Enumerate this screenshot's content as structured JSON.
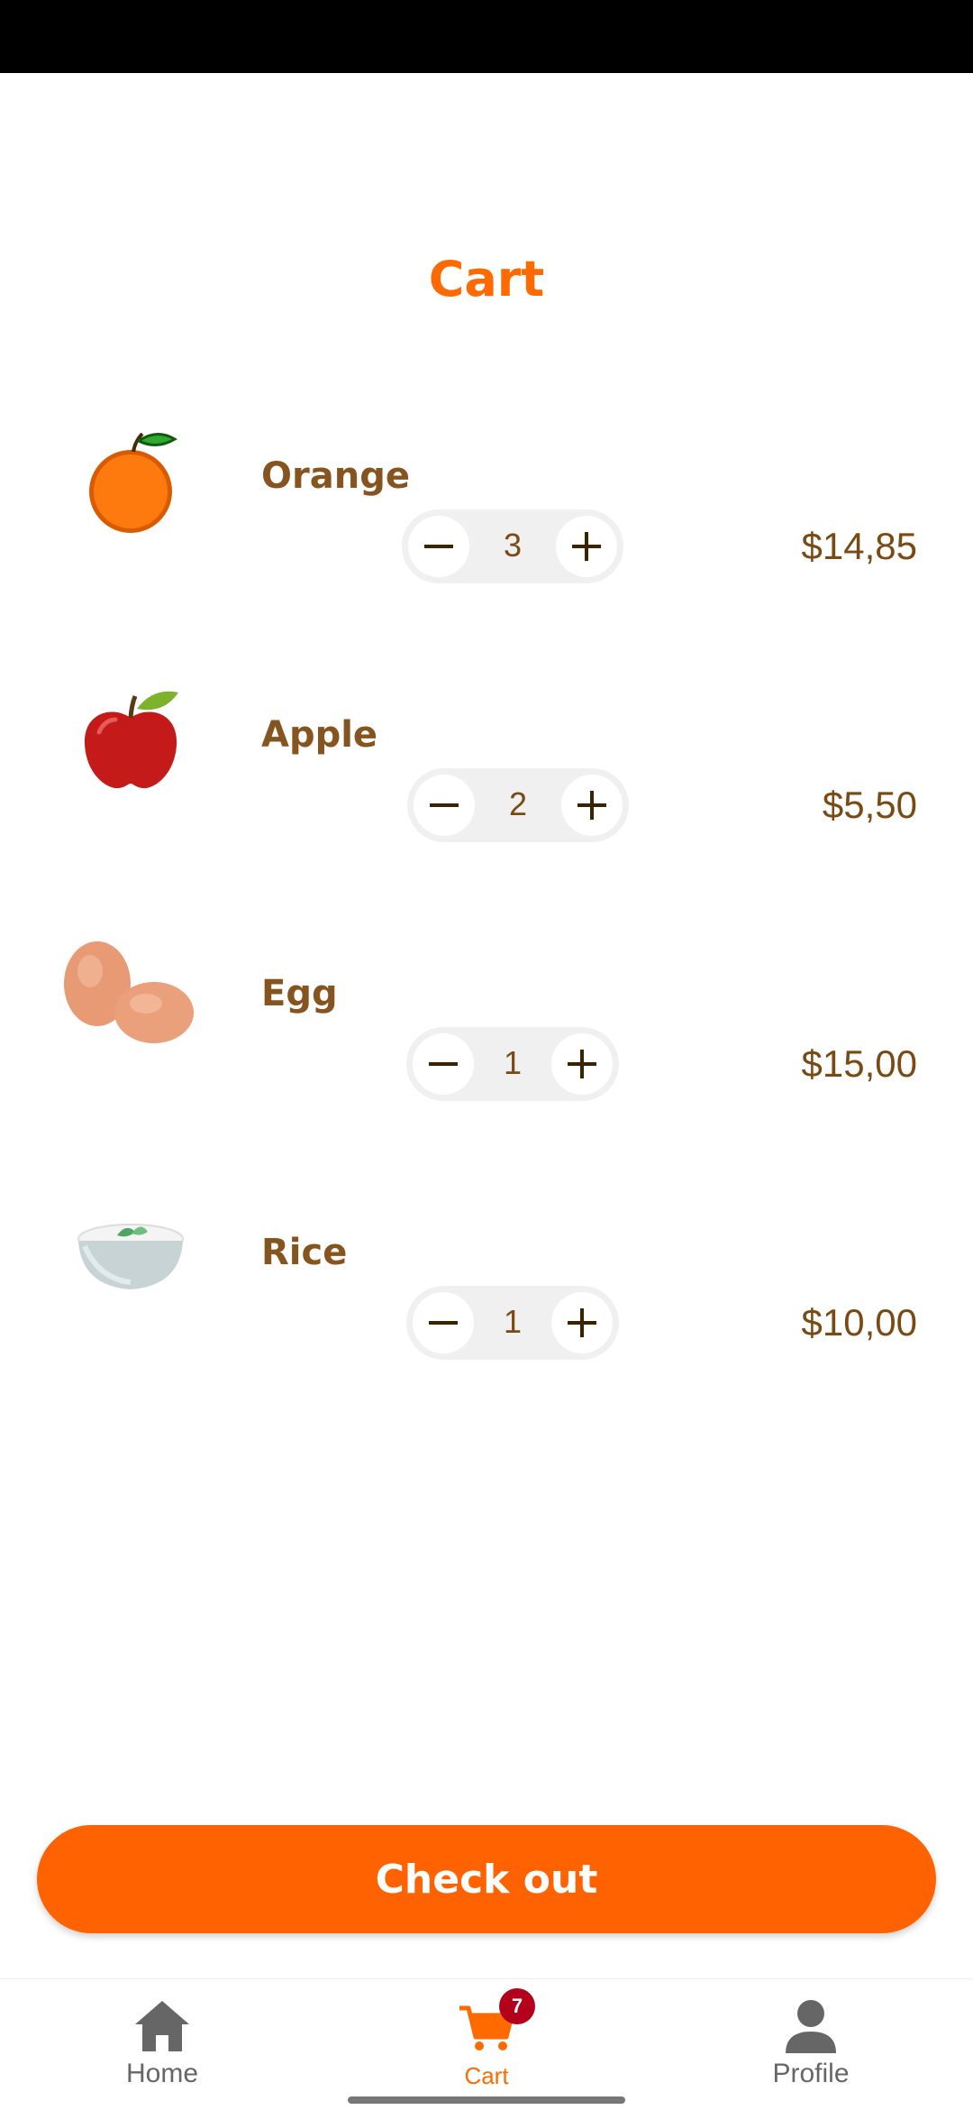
{
  "page": {
    "title": "Cart"
  },
  "items": [
    {
      "name": "Orange",
      "quantity": "3",
      "price": "$14,85",
      "image": "orange-icon"
    },
    {
      "name": "Apple",
      "quantity": "2",
      "price": "$5,50",
      "image": "apple-icon"
    },
    {
      "name": "Egg",
      "quantity": "1",
      "price": "$15,00",
      "image": "eggs-icon"
    },
    {
      "name": "Rice",
      "quantity": "1",
      "price": "$10,00",
      "image": "rice-bowl-icon"
    }
  ],
  "checkout": {
    "label": "Check out"
  },
  "nav": {
    "items": [
      {
        "label": "Home",
        "icon": "home-icon"
      },
      {
        "label": "Cart",
        "icon": "cart-icon",
        "badge": "7"
      },
      {
        "label": "Profile",
        "icon": "profile-icon"
      }
    ]
  },
  "colors": {
    "accent": "#ff6a00",
    "text": "#7a4a14",
    "badge": "#b3001b"
  }
}
